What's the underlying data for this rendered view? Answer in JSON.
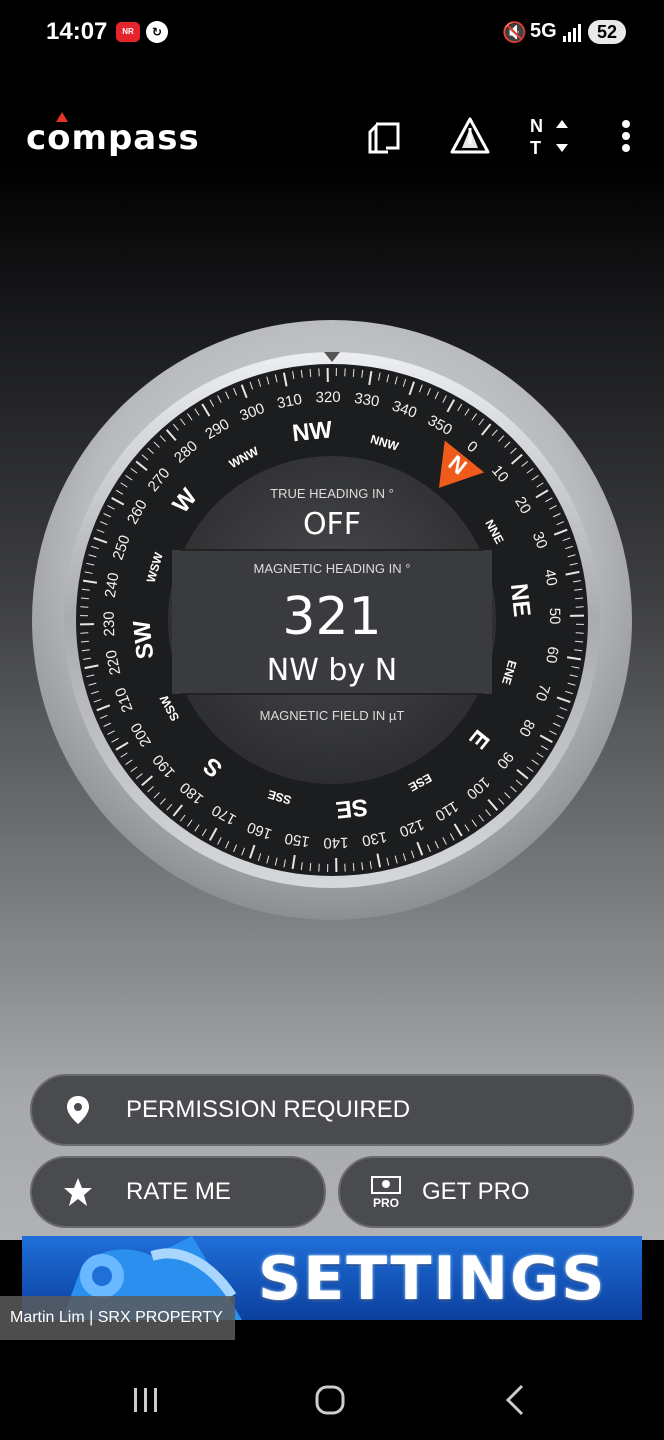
{
  "status_bar": {
    "time": "14:07",
    "app_badge": "NR",
    "sync_glyph": "↻",
    "mute_glyph": "🔇",
    "network": "5G",
    "battery": "52"
  },
  "app_bar": {
    "logo": "compass",
    "icons": [
      "layout-toggle-icon",
      "warning-icon",
      "north-toggle-icon",
      "more-vert-icon"
    ],
    "north_toggle_top": "N",
    "north_toggle_bottom": "T"
  },
  "compass": {
    "degree_labels": [
      "0",
      "10",
      "20",
      "30",
      "40",
      "50",
      "60",
      "70",
      "80",
      "90",
      "100",
      "110",
      "120",
      "130",
      "140",
      "150",
      "160",
      "170",
      "180",
      "190",
      "200",
      "210",
      "220",
      "230",
      "240",
      "250",
      "260",
      "270",
      "280",
      "290",
      "300",
      "310",
      "320",
      "330",
      "340",
      "350"
    ],
    "cardinals": [
      "N",
      "NNE",
      "NE",
      "ENE",
      "E",
      "ESE",
      "SE",
      "SSE",
      "S",
      "SSW",
      "SW",
      "WSW",
      "W",
      "WNW",
      "NW",
      "NNW"
    ],
    "heading_deg": 321,
    "true_heading_label": "TRUE HEADING IN °",
    "true_heading_value": "OFF",
    "magnetic_heading_label": "MAGNETIC HEADING IN °",
    "magnetic_heading_value": "321",
    "direction_text": "NW by N",
    "magnetic_field_label": "MAGNETIC FIELD IN µT",
    "accent_color": "#f05a1a"
  },
  "actions": {
    "permission": "PERMISSION REQUIRED",
    "rate": "RATE ME",
    "pro": "GET PRO",
    "pro_badge": "PRO"
  },
  "ad": {
    "text": "SETTINGS"
  },
  "watermark": "Martin Lim | SRX PROPERTY"
}
